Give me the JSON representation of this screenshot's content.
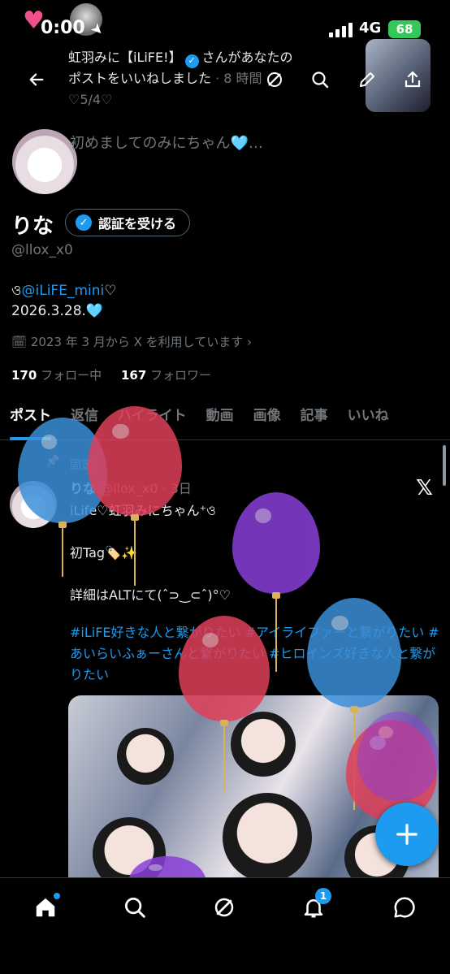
{
  "status_bar": {
    "time": "0:00",
    "network": "4G",
    "battery": "68"
  },
  "header": {
    "notification_line1": "虹羽みに【iLiFE!】",
    "notification_line1_suffix": "さんがあなたの",
    "notification_line2": "ポストをいいねしました",
    "notification_line2_time": " · 8 時間",
    "notification_line3": "♡5/4♡"
  },
  "profile": {
    "bio_teaser": "初めましてのみにちゃん🩵…",
    "display_name": "りな",
    "verify_button": "認証を受ける",
    "handle": "@llox_x0",
    "bio_prefix": "ও",
    "bio_mention": "@iLiFE_mini",
    "bio_suffix": "♡",
    "bio_line2": "2026.3.28.🩵",
    "joined": "2023 年 3 月から X を利用しています",
    "following_count": "170",
    "following_label": "フォロー中",
    "followers_count": "167",
    "followers_label": "フォロワー"
  },
  "tabs": [
    "ポスト",
    "返信",
    "ハイライト",
    "動画",
    "画像",
    "記事",
    "いいね"
  ],
  "post": {
    "pinned_label": "固定",
    "author": "りな",
    "handle_time": "@llox_x0 · 3日",
    "text": "iLife♡虹羽みにちゃん⁺ও\n\n初Tag🏷️✨\n\n詳細はALTにて(ˆ⊃‿⊂ˆ)°♡",
    "hashtags": "#iLiFE好きな人と繋がりたい #アイライファーと繋がりたい #あいらいふぁーさんと繋がりたい #ヒロインズ好きな人と繋がりたい"
  },
  "bottom_nav": {
    "notification_badge": "1"
  },
  "colors": {
    "accent": "#1d9bf0",
    "background": "#000000",
    "balloon_blue": "#3b8fd9",
    "balloon_red": "#e0405a",
    "balloon_purple": "#8a3fd9"
  },
  "icons": [
    "back-arrow-icon",
    "grok-icon",
    "search-icon",
    "edit-icon",
    "share-icon",
    "calendar-icon",
    "chevron-right-icon",
    "pin-icon",
    "x-logo-icon",
    "plus-icon",
    "home-icon",
    "explore-icon",
    "grok-icon",
    "bell-icon",
    "messages-icon"
  ]
}
